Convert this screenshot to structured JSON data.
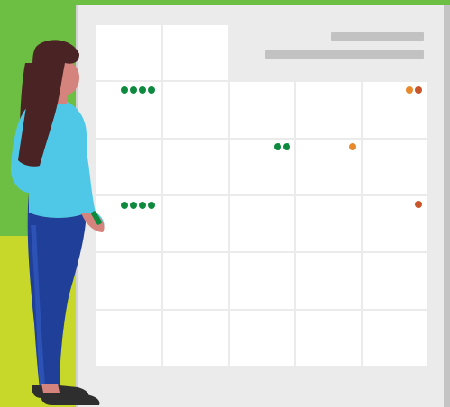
{
  "colors": {
    "background_top": "#6dbf44",
    "background_bottom": "#c8d82a",
    "board": "#ebebeb",
    "board_edge": "#c4c4c4",
    "grid_cell": "#ffffff",
    "header_bar": "#c2c2c2",
    "dot_green": "#0d8a3e",
    "dot_orange": "#e8892b",
    "dot_dark_orange": "#c9562a",
    "hair": "#4a2424",
    "skin": "#d4847c",
    "shirt": "#4fc8e8",
    "jeans": "#1f3f99",
    "shoes": "#2e2e2e",
    "marker": "#0d8a3e"
  },
  "calendar": {
    "columns": 5,
    "rows": 6,
    "event_dots": [
      {
        "row": 1,
        "col": 0,
        "count": 4,
        "color": "green"
      },
      {
        "row": 1,
        "col": 4,
        "count": 1,
        "color": "orange"
      },
      {
        "row": 1,
        "col": 4,
        "count": 1,
        "color": "dark_orange"
      },
      {
        "row": 2,
        "col": 2,
        "count": 2,
        "color": "green"
      },
      {
        "row": 2,
        "col": 3,
        "count": 1,
        "color": "orange"
      },
      {
        "row": 3,
        "col": 0,
        "count": 4,
        "color": "green"
      },
      {
        "row": 3,
        "col": 4,
        "count": 1,
        "color": "dark_orange"
      }
    ]
  },
  "icons": {
    "figure": "woman-with-marker-icon"
  }
}
